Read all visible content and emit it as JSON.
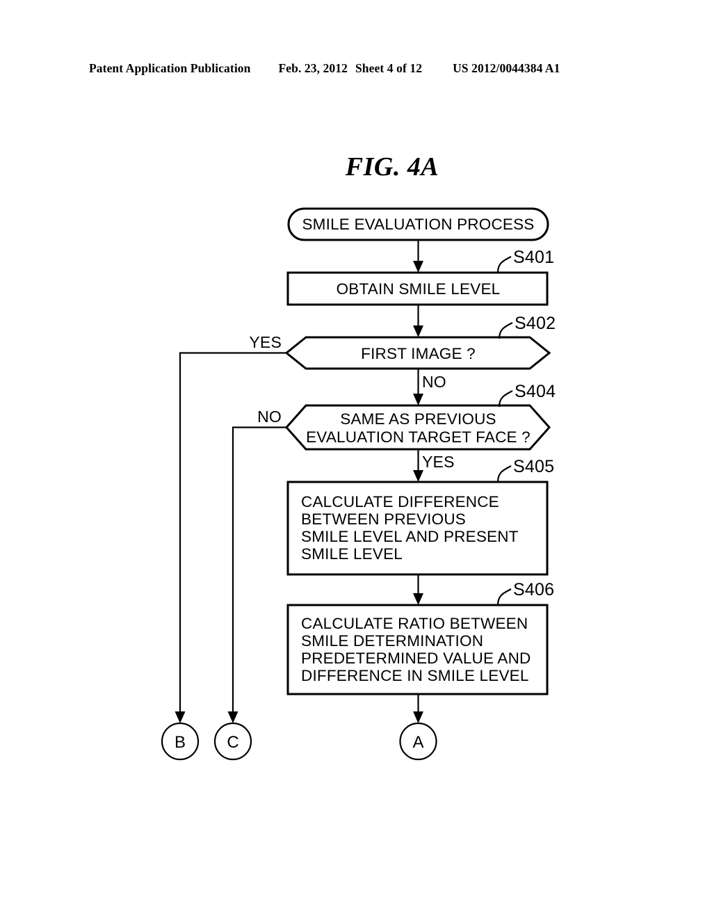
{
  "header": {
    "publication": "Patent Application Publication",
    "date": "Feb. 23, 2012",
    "sheet": "Sheet 4 of 12",
    "patent_number": "US 2012/0044384 A1"
  },
  "figure": {
    "title": "FIG. 4A"
  },
  "flowchart": {
    "start": {
      "label": "SMILE EVALUATION PROCESS"
    },
    "steps": [
      {
        "id": "S401",
        "step_label": "S401",
        "shape": "process",
        "lines": [
          "OBTAIN SMILE LEVEL"
        ]
      },
      {
        "id": "S402",
        "step_label": "S402",
        "shape": "decision",
        "lines": [
          "FIRST IMAGE ?"
        ],
        "branch_left": "YES",
        "branch_down": "NO"
      },
      {
        "id": "S404",
        "step_label": "S404",
        "shape": "decision",
        "lines": [
          "SAME AS PREVIOUS",
          "EVALUATION TARGET FACE ?"
        ],
        "branch_left": "NO",
        "branch_down": "YES"
      },
      {
        "id": "S405",
        "step_label": "S405",
        "shape": "process",
        "lines": [
          "CALCULATE DIFFERENCE",
          "BETWEEN PREVIOUS",
          "SMILE LEVEL AND PRESENT",
          "SMILE LEVEL"
        ]
      },
      {
        "id": "S406",
        "step_label": "S406",
        "shape": "process",
        "lines": [
          "CALCULATE RATIO BETWEEN",
          "SMILE DETERMINATION",
          "PREDETERMINED VALUE AND",
          "DIFFERENCE IN SMILE LEVEL"
        ]
      }
    ],
    "connectors": [
      {
        "id": "conn-b",
        "label": "B"
      },
      {
        "id": "conn-c",
        "label": "C"
      },
      {
        "id": "conn-a",
        "label": "A"
      }
    ],
    "colors": {
      "stroke": "#000000",
      "fill": "#ffffff"
    }
  }
}
